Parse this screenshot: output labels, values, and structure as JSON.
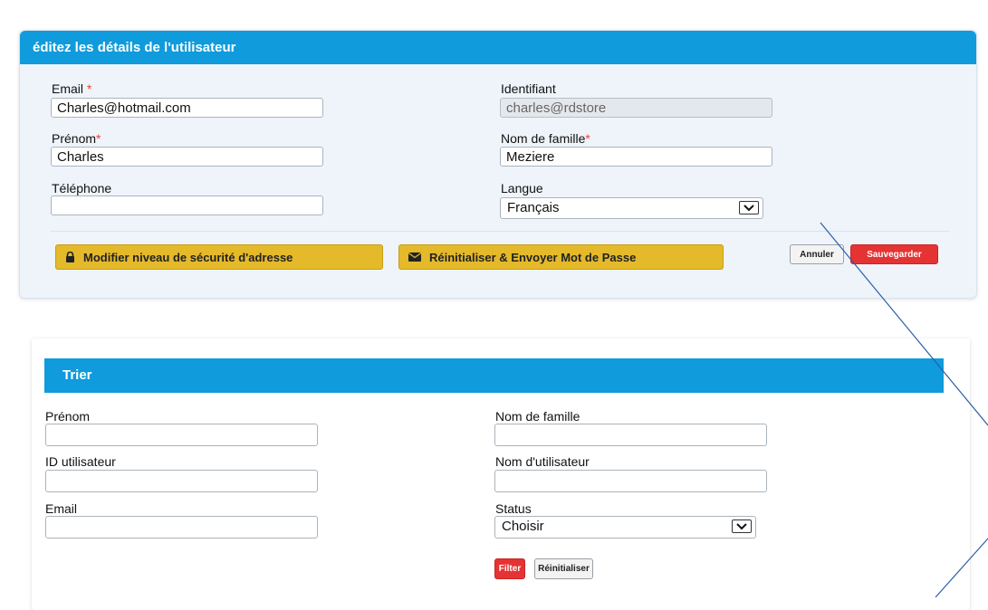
{
  "edit_panel": {
    "title": "éditez les détails de l'utilisateur",
    "email": {
      "label": "Email ",
      "required": "*",
      "value": "Charles@hotmail.com"
    },
    "identifiant": {
      "label": "Identifiant",
      "value": "charles@rdstore"
    },
    "prenom": {
      "label": "Prénom",
      "required": "*",
      "value": "Charles"
    },
    "nom": {
      "label": "Nom de famille",
      "required": "*",
      "value": "Meziere"
    },
    "telephone": {
      "label": "Téléphone",
      "value": ""
    },
    "langue": {
      "label": "Langue",
      "value": "Français"
    },
    "btn_security": "Modifier niveau de sécurité d'adresse",
    "btn_reset_send": "Réinitialiser & Envoyer Mot de Passe",
    "btn_cancel": "Annuler",
    "btn_save": "Sauvegarder"
  },
  "filter_panel": {
    "title": "Trier",
    "prenom": {
      "label": "Prénom",
      "value": ""
    },
    "nom": {
      "label": "Nom de famille",
      "value": ""
    },
    "id_user": {
      "label": "ID utilisateur",
      "value": ""
    },
    "username": {
      "label": "Nom d'utilisateur",
      "value": ""
    },
    "email": {
      "label": "Email",
      "value": ""
    },
    "status": {
      "label": "Status",
      "value": "Choisir"
    },
    "btn_filter": "Filter",
    "btn_reset": "Réinitialiser"
  },
  "icons": {
    "lock": "lock-icon",
    "envelope": "envelope-icon",
    "chevron": "chevron-down-icon"
  },
  "colors": {
    "header_blue": "#0f9bdc",
    "button_yellow": "#e4b92a",
    "button_red": "#e53333",
    "required_red": "#ee4433",
    "annotation_line": "#2b5fa6"
  }
}
